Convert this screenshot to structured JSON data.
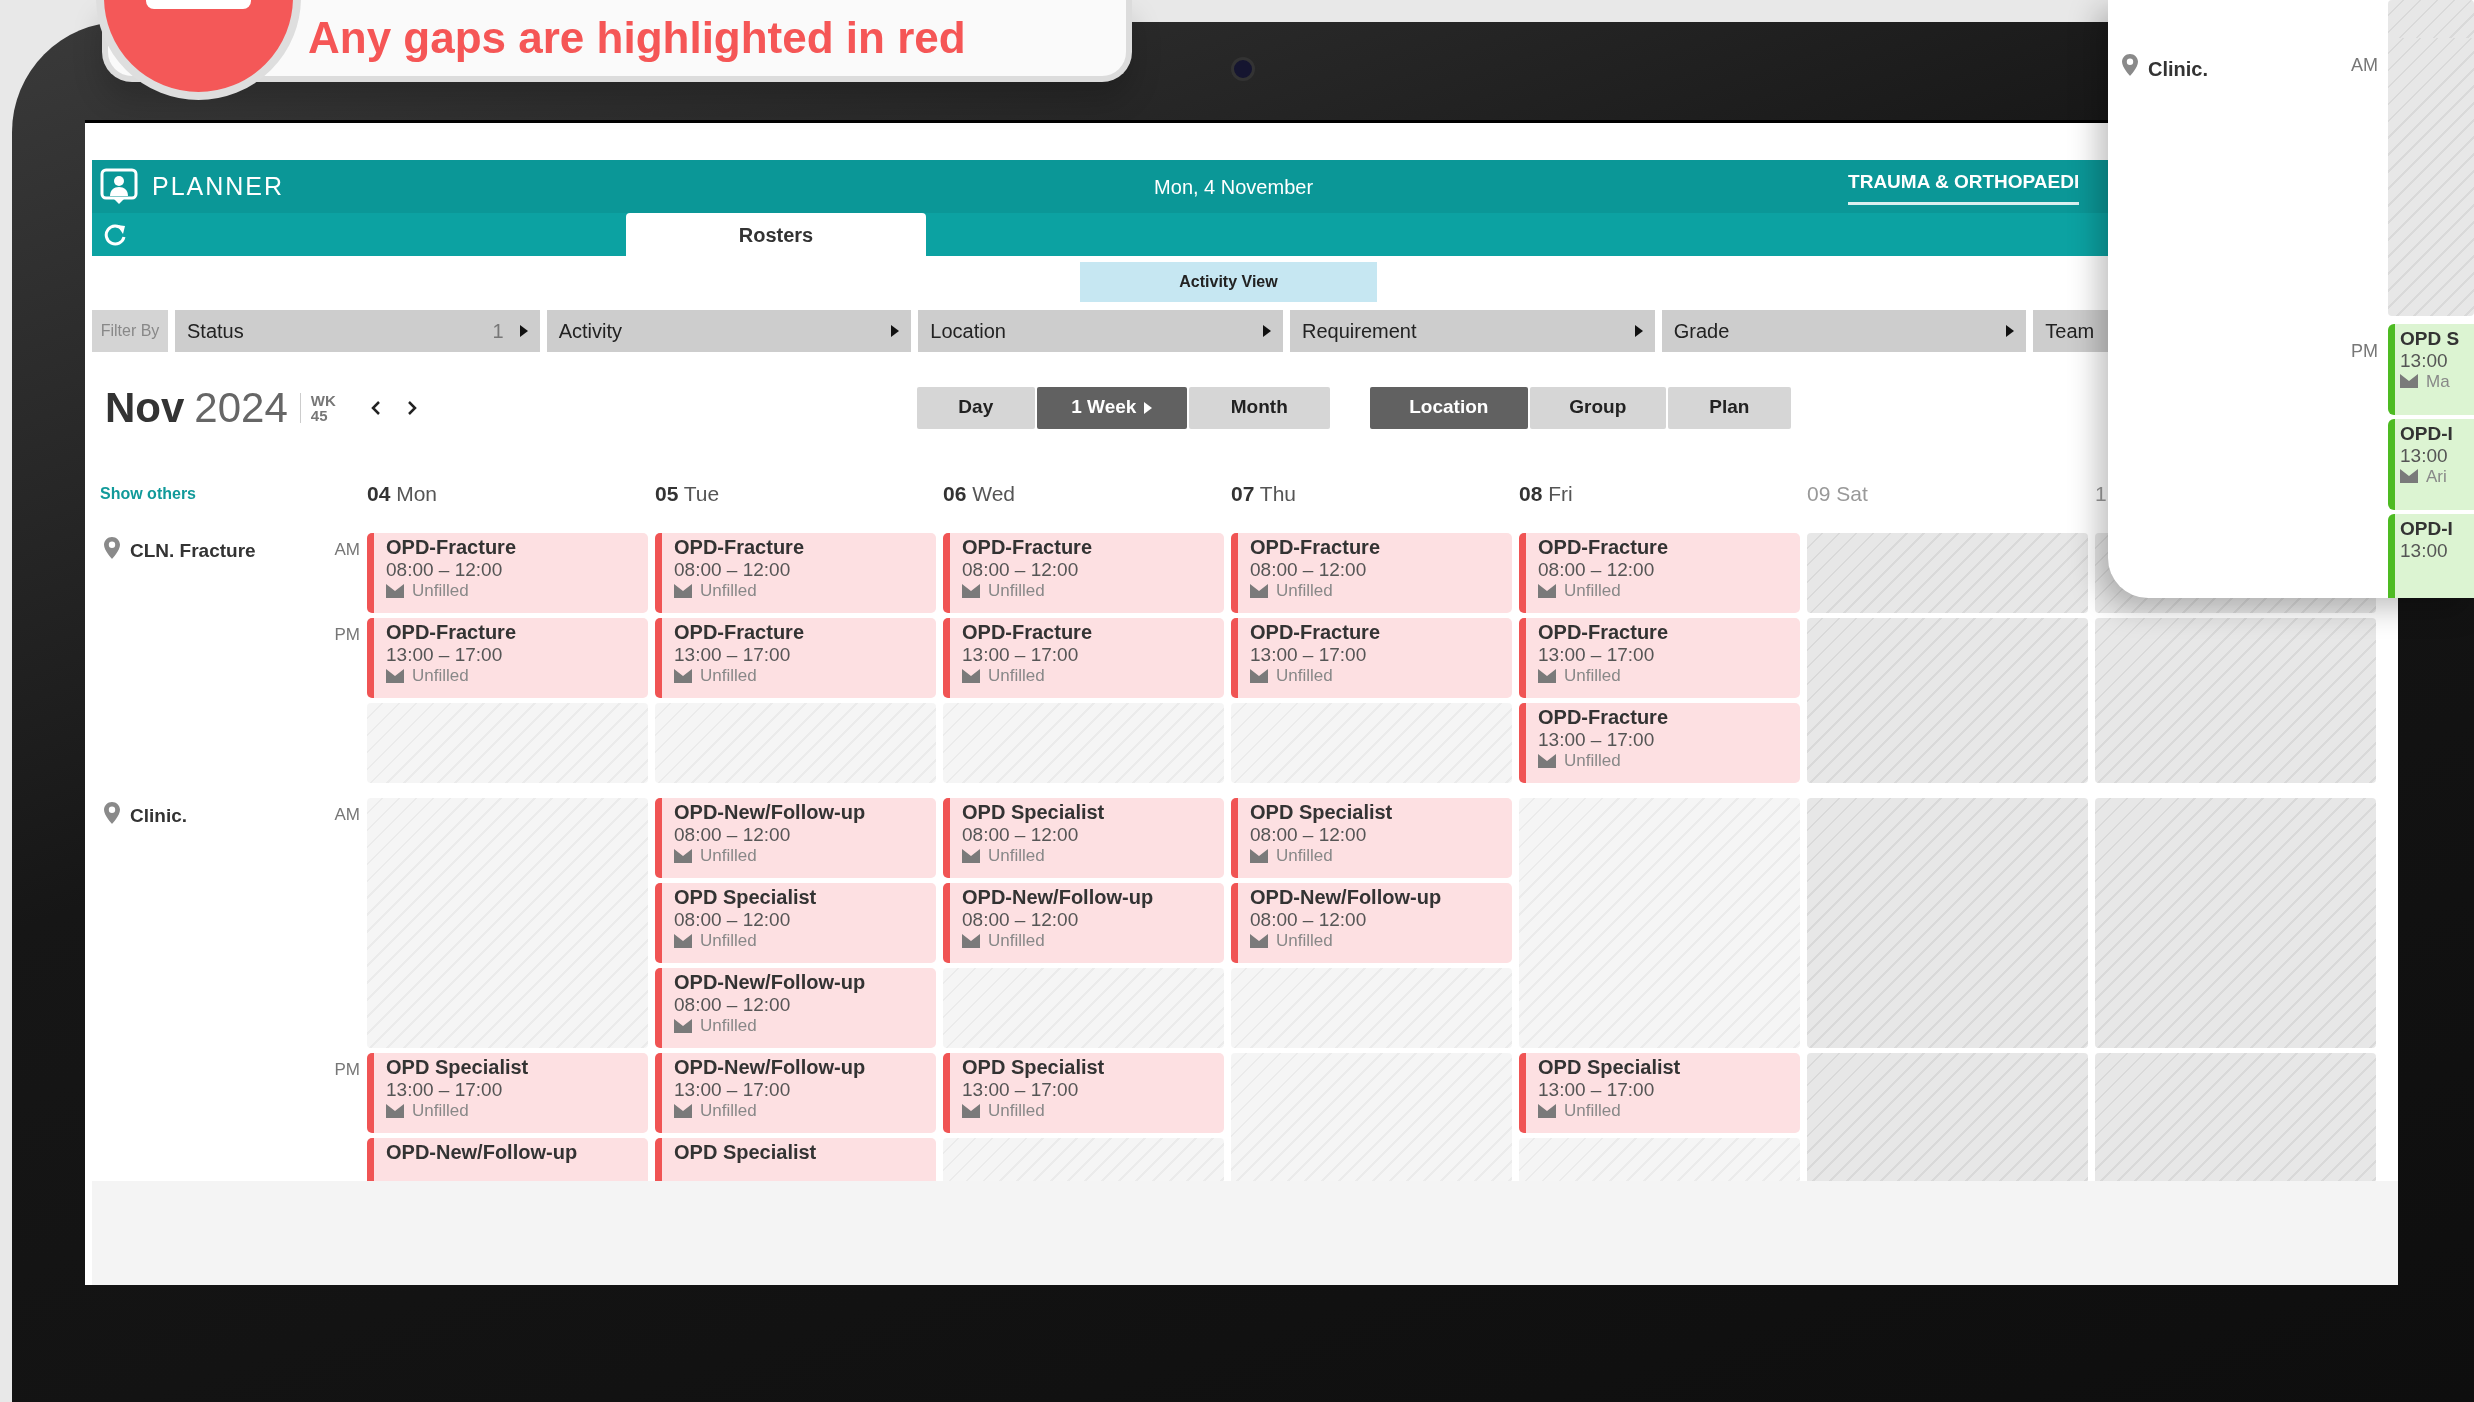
{
  "callout": {
    "text": "Any gaps are highlighted in red"
  },
  "header": {
    "app_name": "PLANNER",
    "date": "Mon, 4 November",
    "department": "TRAUMA & ORTHOPAEDI"
  },
  "tabs": [
    {
      "label": "Rosters",
      "selected": true
    }
  ],
  "activity_view": {
    "label": "Activity View"
  },
  "filters": {
    "label": "Filter By",
    "items": [
      {
        "label": "Status",
        "count": "1",
        "caret": true
      },
      {
        "label": "Activity",
        "caret": true
      },
      {
        "label": "Location",
        "caret": true
      },
      {
        "label": "Requirement",
        "caret": true
      },
      {
        "label": "Grade",
        "caret": true
      },
      {
        "label": "Team"
      }
    ]
  },
  "period": {
    "month": "Nov",
    "year": "2024",
    "week_label": "WK",
    "week": "45"
  },
  "views": [
    {
      "label": "Day",
      "selected": false,
      "caret": false
    },
    {
      "label": "1 Week",
      "selected": true,
      "caret": true
    },
    {
      "label": "Month",
      "selected": false,
      "caret": false
    }
  ],
  "groupings": [
    {
      "label": "Location",
      "selected": true
    },
    {
      "label": "Group",
      "selected": false
    },
    {
      "label": "Plan",
      "selected": false
    }
  ],
  "show_others": "Show others",
  "days": [
    {
      "number": "04",
      "name": "Mon",
      "weekend": false
    },
    {
      "number": "05",
      "name": "Tue",
      "weekend": false
    },
    {
      "number": "06",
      "name": "Wed",
      "weekend": false
    },
    {
      "number": "07",
      "name": "Thu",
      "weekend": false
    },
    {
      "number": "08",
      "name": "Fri",
      "weekend": false
    },
    {
      "number": "09",
      "name": "Sat",
      "weekend": true
    },
    {
      "number": "1",
      "weekend": true
    }
  ],
  "locations": [
    {
      "name": "CLN. Fracture",
      "periods": [
        {
          "label": "AM",
          "days": [
            {
              "cards": [
                {
                  "title": "OPD-Fracture",
                  "time": "08:00 – 12:00",
                  "status": "Unfilled",
                  "filled": false
                }
              ]
            },
            {
              "cards": [
                {
                  "title": "OPD-Fracture",
                  "time": "08:00 – 12:00",
                  "status": "Unfilled",
                  "filled": false
                }
              ]
            },
            {
              "cards": [
                {
                  "title": "OPD-Fracture",
                  "time": "08:00 – 12:00",
                  "status": "Unfilled",
                  "filled": false
                }
              ]
            },
            {
              "cards": [
                {
                  "title": "OPD-Fracture",
                  "time": "08:00 – 12:00",
                  "status": "Unfilled",
                  "filled": false
                }
              ]
            },
            {
              "cards": [
                {
                  "title": "OPD-Fracture",
                  "time": "08:00 – 12:00",
                  "status": "Unfilled",
                  "filled": false
                }
              ]
            },
            {
              "gap": true
            },
            {
              "gap": true
            }
          ]
        },
        {
          "label": "PM",
          "days": [
            {
              "cards": [
                {
                  "title": "OPD-Fracture",
                  "time": "13:00 – 17:00",
                  "status": "Unfilled",
                  "filled": false
                }
              ]
            },
            {
              "cards": [
                {
                  "title": "OPD-Fracture",
                  "time": "13:00 – 17:00",
                  "status": "Unfilled",
                  "filled": false
                }
              ]
            },
            {
              "cards": [
                {
                  "title": "OPD-Fracture",
                  "time": "13:00 – 17:00",
                  "status": "Unfilled",
                  "filled": false
                }
              ]
            },
            {
              "cards": [
                {
                  "title": "OPD-Fracture",
                  "time": "13:00 – 17:00",
                  "status": "Unfilled",
                  "filled": false
                }
              ]
            },
            {
              "cards": [
                {
                  "title": "OPD-Fracture",
                  "time": "13:00 – 17:00",
                  "status": "Unfilled",
                  "filled": false
                },
                {
                  "title": "OPD-Fracture",
                  "time": "13:00 – 17:00",
                  "status": "Unfilled",
                  "filled": false
                }
              ]
            },
            {
              "gap": true
            },
            {
              "gap": true
            }
          ]
        }
      ]
    },
    {
      "name": "Clinic.",
      "periods": [
        {
          "label": "AM",
          "days": [
            {
              "gap": true
            },
            {
              "cards": [
                {
                  "title": "OPD-New/Follow-up",
                  "time": "08:00 – 12:00",
                  "status": "Unfilled",
                  "filled": false
                },
                {
                  "title": "OPD Specialist",
                  "time": "08:00 – 12:00",
                  "status": "Unfilled",
                  "filled": false
                },
                {
                  "title": "OPD-New/Follow-up",
                  "time": "08:00 – 12:00",
                  "status": "Unfilled",
                  "filled": false
                }
              ]
            },
            {
              "cards": [
                {
                  "title": "OPD Specialist",
                  "time": "08:00 – 12:00",
                  "status": "Unfilled",
                  "filled": false
                },
                {
                  "title": "OPD-New/Follow-up",
                  "time": "08:00 – 12:00",
                  "status": "Unfilled",
                  "filled": false
                }
              ]
            },
            {
              "cards": [
                {
                  "title": "OPD Specialist",
                  "time": "08:00 – 12:00",
                  "status": "Unfilled",
                  "filled": false
                },
                {
                  "title": "OPD-New/Follow-up",
                  "time": "08:00 – 12:00",
                  "status": "Unfilled",
                  "filled": false
                }
              ]
            },
            {
              "gap": true
            },
            {
              "gap": true
            },
            {
              "gap": true
            }
          ]
        },
        {
          "label": "PM",
          "days": [
            {
              "cards": [
                {
                  "title": "OPD Specialist",
                  "time": "13:00 – 17:00",
                  "status": "Unfilled",
                  "filled": false
                },
                {
                  "title": "OPD-New/Follow-up",
                  "filled": false
                }
              ]
            },
            {
              "cards": [
                {
                  "title": "OPD-New/Follow-up",
                  "time": "13:00 – 17:00",
                  "status": "Unfilled",
                  "filled": false
                },
                {
                  "title": "OPD Specialist",
                  "filled": false
                }
              ]
            },
            {
              "cards": [
                {
                  "title": "OPD Specialist",
                  "time": "13:00 – 17:00",
                  "status": "Unfilled",
                  "filled": false
                }
              ]
            },
            {
              "gap": true
            },
            {
              "cards": [
                {
                  "title": "OPD Specialist",
                  "time": "13:00 – 17:00",
                  "status": "Unfilled",
                  "filled": false
                }
              ]
            },
            {
              "gap": true
            },
            {
              "gap": true
            }
          ]
        }
      ]
    }
  ],
  "zoom_panel": {
    "location": "Clinic.",
    "periods": [
      {
        "label": "AM",
        "gap": true
      },
      {
        "label": "PM",
        "cards": [
          {
            "title": "OPD S",
            "time": "13:00",
            "status": "Ma",
            "filled": true
          },
          {
            "title": "OPD-I",
            "time": "13:00",
            "status": "Ari",
            "filled": true
          },
          {
            "title": "OPD-I",
            "time": "13:00",
            "filled": true
          }
        ]
      }
    ]
  }
}
